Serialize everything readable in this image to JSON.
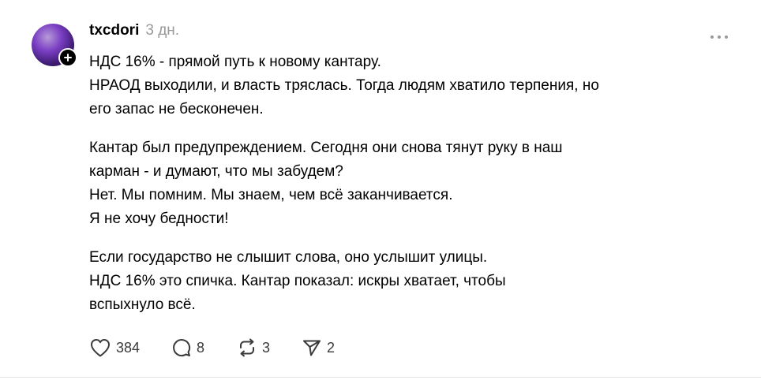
{
  "post": {
    "author": {
      "username": "txcdori",
      "avatar_icon": "avatar-image",
      "follow_icon": "plus-icon"
    },
    "timestamp": "3 дн.",
    "more_icon": "more-horizontal-icon",
    "paragraphs": [
      {
        "lines": [
          "НДС 16% - прямой путь к новому кантару.",
          "НРАОД выходили, и власть тряслась. Тогда людям хватило терпения, но",
          "его запас не бесконечен."
        ]
      },
      {
        "lines": [
          "Кантар был предупреждением. Сегодня они снова тянут руку в наш",
          "карман - и думают, что мы забудем?",
          "Нет. Мы помним. Мы знаем, чем всё заканчивается.",
          "Я не хочу бедности!"
        ]
      },
      {
        "lines": [
          "Если государство не слышит слова, оно услышит улицы.",
          "НДС 16% это спичка. Кантар показал: искры хватает, чтобы",
          "вспыхнуло всё."
        ]
      }
    ],
    "actions": {
      "likes": "384",
      "replies": "8",
      "reposts": "3",
      "shares": "2"
    }
  },
  "colors": {
    "text": "#000000",
    "muted": "#999999",
    "icon": "#3a3a3a",
    "divider": "#e5e5e5"
  }
}
